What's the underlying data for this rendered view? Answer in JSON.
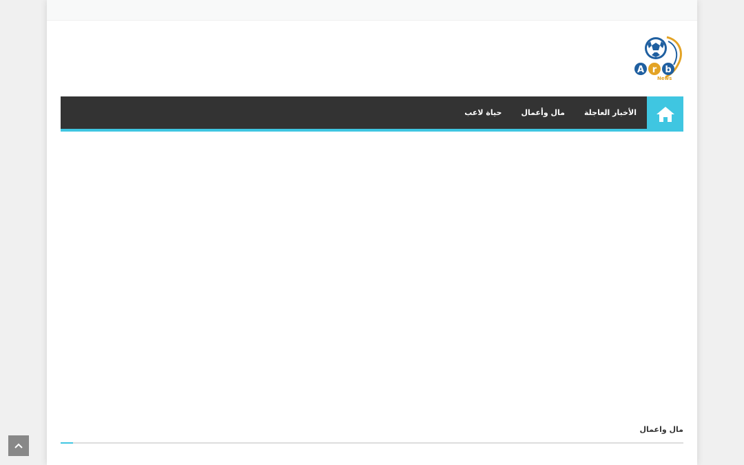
{
  "logo": {
    "letters": [
      "A",
      "r",
      "b"
    ],
    "subtitle": "News"
  },
  "nav": {
    "home_icon": "home-icon",
    "items": [
      {
        "label": "الأخبار العاجلة"
      },
      {
        "label": "مال وأعمال"
      },
      {
        "label": "حياة لاعب"
      }
    ]
  },
  "section": {
    "title": "مال واعمال"
  },
  "scroll_top": {
    "icon": "chevron-up-icon"
  },
  "colors": {
    "accent": "#3fc6e1",
    "navbar": "#333333",
    "logo_blue": "#1f5fa0",
    "logo_orange": "#e3a325",
    "scroll_button": "#888888"
  }
}
